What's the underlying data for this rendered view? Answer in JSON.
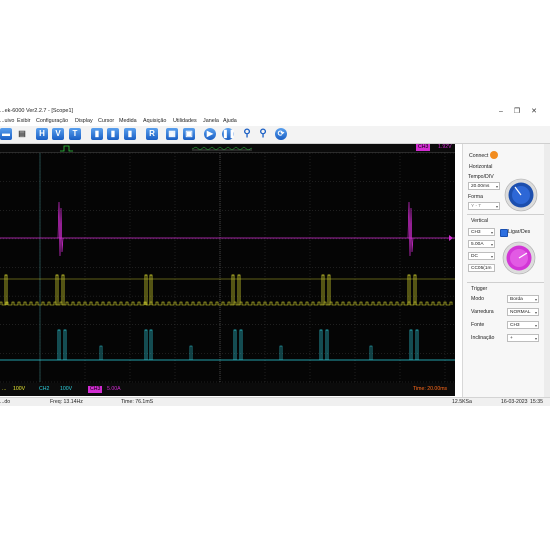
{
  "window": {
    "title": "...ek-6000 Ver2.2.7 - [Scope1]",
    "buttons": {
      "minimize": "–",
      "maximize": "❐",
      "close": "✕"
    }
  },
  "menu": [
    "...uivo",
    "Exibir",
    "Configuração",
    "Display",
    "Cursor",
    "Medida",
    "Aquisição",
    "Utilidades",
    "Janela",
    "Ajuda"
  ],
  "toolbar": {
    "letters": [
      "H",
      "V",
      "T"
    ],
    "rb_label": "R"
  },
  "scope": {
    "ch3_top_tag": "CH3",
    "ch3_top_value": "1.92V",
    "ch1_label": "...",
    "ch1_value": "100V",
    "ch2_label": "CH2",
    "ch2_value": "100V",
    "ch3_label": "CH3",
    "ch3_value": "5.00A",
    "time_label": "Time: 20.00ms",
    "colors": {
      "ch1": "#e6e632",
      "ch2": "#2fd2e0",
      "ch3": "#d22cd2",
      "grid": "#3a3a3a"
    }
  },
  "statusbar": {
    "left": "...do",
    "freq": "Freq: 13.14Hz",
    "time": "Time: 76.1mS",
    "rate": "12.5KSa",
    "date": "16-03-2023",
    "clock": "15:35"
  },
  "panel": {
    "connect": "Connect",
    "horizontal": "Horizontal",
    "tempo_div": "Tempo/DIV",
    "tempo_value": "20.00ms",
    "forma": "Forma",
    "forma_value": "Y - T",
    "vertical": "Vertical",
    "channel": "CH3",
    "ligar_des": "Ligar/Des",
    "volts": "5.00A",
    "coupling": "DC",
    "probe": "CC05(1m",
    "trigger": "Trigger",
    "modo": "Modo",
    "modo_value": "Borda",
    "varredura": "Varredura",
    "varredura_value": "NORMAL",
    "fonte": "Fonte",
    "fonte_value": "CH3",
    "inclinacao": "Inclinação",
    "inclinacao_value": "+"
  }
}
